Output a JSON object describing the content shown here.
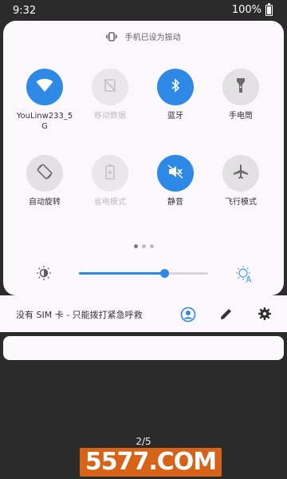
{
  "status_bar": {
    "time": "9:32",
    "battery": "100%"
  },
  "vibrate_text": "手机已设为振动",
  "tiles": [
    {
      "label": "YouLinw233_5\nG",
      "state": "on",
      "icon": "wifi-icon"
    },
    {
      "label": "移动数据",
      "state": "disabled",
      "icon": "mobile-data-off-icon"
    },
    {
      "label": "蓝牙",
      "state": "on",
      "icon": "bluetooth-icon"
    },
    {
      "label": "手电筒",
      "state": "off",
      "icon": "flashlight-icon"
    },
    {
      "label": "自动旋转",
      "state": "off",
      "icon": "auto-rotate-icon"
    },
    {
      "label": "省电模式",
      "state": "disabled",
      "icon": "battery-saver-icon"
    },
    {
      "label": "静音",
      "state": "on",
      "icon": "mute-icon"
    },
    {
      "label": "飞行模式",
      "state": "off",
      "icon": "airplane-icon"
    }
  ],
  "page_dots": {
    "count": 3,
    "active": 0
  },
  "brightness": {
    "level": 0.66
  },
  "footer": {
    "carrier_text": "没有 SIM 卡 - 只能拨打紧急呼救电话"
  },
  "page_indicator": "2/5",
  "watermark": "5577.COM",
  "colors": {
    "accent": "#2e89e6",
    "panel": "#fbf8fb",
    "background": "#2b2b2b"
  }
}
